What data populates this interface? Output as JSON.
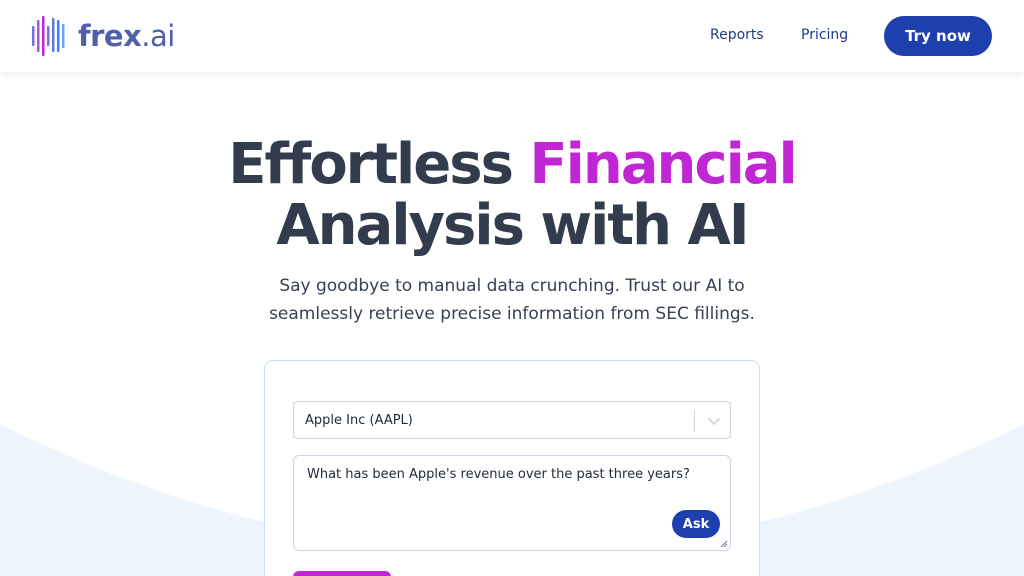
{
  "brand": {
    "name": "frex",
    "suffix": ".ai",
    "color": "#4f5fa8"
  },
  "nav": {
    "reports": "Reports",
    "pricing": "Pricing",
    "try_now": "Try now"
  },
  "hero": {
    "title_part1": "Effortless ",
    "title_accent": "Financial",
    "title_part2": "Analysis with AI",
    "subtitle_line1": "Say goodbye to manual data crunching. Trust our AI to",
    "subtitle_line2": "seamlessly retrieve precise information from SEC fillings."
  },
  "form": {
    "company_select": {
      "value": "Apple Inc (AAPL)",
      "icon": "chevron-down-icon"
    },
    "question": {
      "value": "What has been Apple's revenue over the past three years?"
    },
    "ask_label": "Ask"
  },
  "colors": {
    "primary": "#1e40af",
    "accent": "#c026d3",
    "heading": "#323c4d",
    "background_arc": "#eef5fc"
  }
}
